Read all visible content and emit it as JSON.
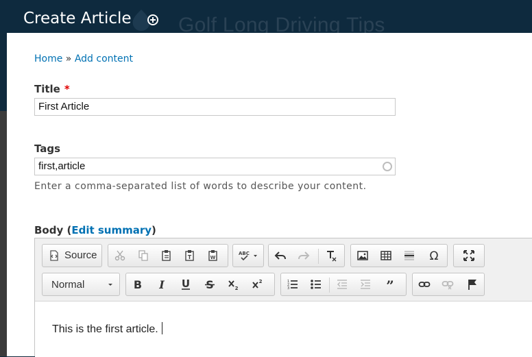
{
  "header": {
    "page_title": "Create Article",
    "site_name": "Golf Long Driving Tips"
  },
  "breadcrumb": {
    "home": "Home",
    "separator": "»",
    "current": "Add content"
  },
  "form": {
    "title": {
      "label": "Title",
      "required_marker": "*",
      "value": "First Article"
    },
    "tags": {
      "label": "Tags",
      "value": "first,article",
      "description": "Enter a comma-separated list of words to describe your content."
    },
    "body": {
      "label": "Body",
      "open_paren": "(",
      "summary_link": "Edit summary",
      "close_paren": ")",
      "content": "This is the first article."
    }
  },
  "toolbar": {
    "source_label": "Source",
    "format_select": "Normal",
    "icons": [
      "source-icon",
      "cut-icon",
      "copy-icon",
      "paste-icon",
      "paste-text-icon",
      "paste-word-icon",
      "spellcheck-icon",
      "undo-icon",
      "redo-icon",
      "remove-format-icon",
      "image-icon",
      "table-icon",
      "horizontal-line-icon",
      "special-char-icon",
      "maximize-icon",
      "bold-icon",
      "italic-icon",
      "underline-icon",
      "strike-icon",
      "subscript-icon",
      "superscript-icon",
      "numbered-list-icon",
      "bulleted-list-icon",
      "outdent-icon",
      "indent-icon",
      "blockquote-icon",
      "link-icon",
      "unlink-icon",
      "anchor-icon"
    ]
  },
  "colors": {
    "header_bg": "#0e2a3e",
    "link": "#0071b3",
    "required": "#e00000"
  }
}
